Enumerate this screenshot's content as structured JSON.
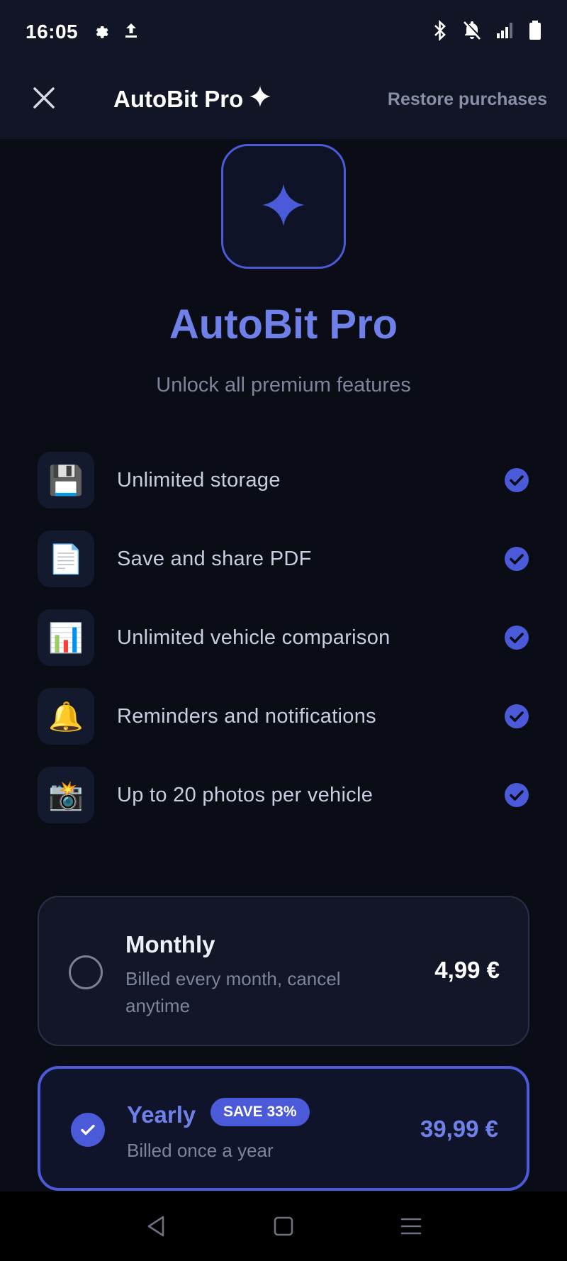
{
  "status_bar": {
    "time": "16:05",
    "left_icons": [
      "gear-icon",
      "upload-icon"
    ],
    "right_icons": [
      "bluetooth-icon",
      "bell-off-icon",
      "signal-icon",
      "battery-icon"
    ]
  },
  "app_bar": {
    "title": "AutoBit Pro",
    "title_icon": "sparkle-icon",
    "close_icon": "close-icon",
    "restore_label": "Restore purchases"
  },
  "hero": {
    "icon": "sparkle-icon",
    "title": "AutoBit Pro",
    "subtitle": "Unlock all premium features"
  },
  "features": [
    {
      "icon": "💾",
      "label": "Unlimited storage",
      "included": true
    },
    {
      "icon": "📄",
      "label": "Save and share PDF",
      "included": true
    },
    {
      "icon": "📊",
      "label": "Unlimited vehicle comparison",
      "included": true
    },
    {
      "icon": "🔔",
      "label": "Reminders and notifications",
      "included": true
    },
    {
      "icon": "📸",
      "label": "Up to 20 photos per vehicle",
      "included": true
    }
  ],
  "plans": {
    "monthly": {
      "name": "Monthly",
      "description": "Billed every month, cancel anytime",
      "price": "4,99 €",
      "selected": false
    },
    "yearly": {
      "name": "Yearly",
      "badge": "SAVE 33%",
      "description": "Billed once a year",
      "price": "39,99 €",
      "selected": true
    }
  },
  "nav_bar": {
    "icons": [
      "back-icon",
      "home-icon",
      "menu-icon"
    ]
  },
  "colors": {
    "accent": "#4a5ad8",
    "accent_text": "#6f80e8",
    "background": "#0a0c16",
    "surface": "#111525"
  }
}
